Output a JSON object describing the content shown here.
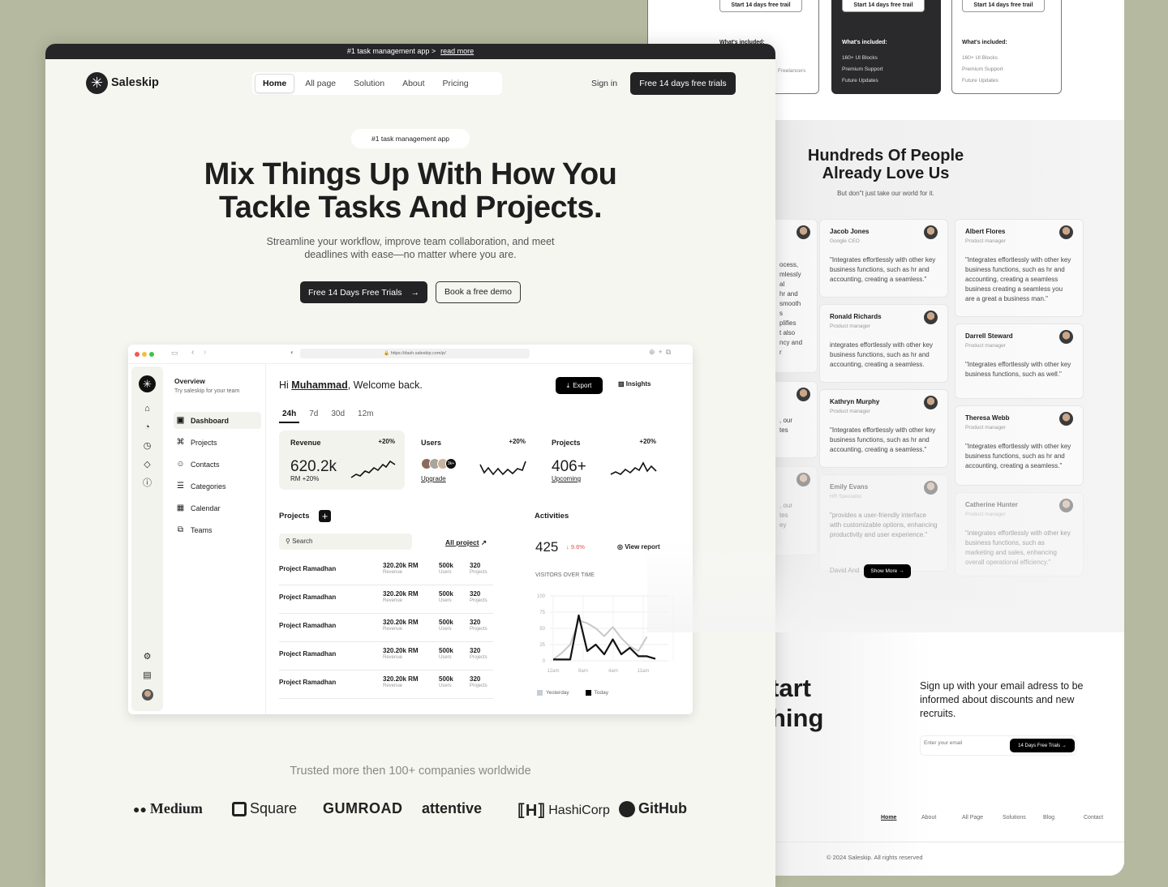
{
  "pricing": {
    "cards": [
      {
        "button": "Start 14 days free trail",
        "included": "What's included:",
        "items": [
          "Freelancers"
        ],
        "style": "light"
      },
      {
        "button": "Start 14 days free trail",
        "included": "What's included:",
        "items": [
          "160+ UI Blocks",
          "Premium Support",
          "Future Updates"
        ],
        "style": "dark"
      },
      {
        "button": "Start 14 days free trail",
        "included": "What's included:",
        "items": [
          "160+ UI Blocks",
          "Premium Support",
          "Future Updates"
        ],
        "style": "light"
      }
    ]
  },
  "testimonials": {
    "title_line1": "Hundreds Of People",
    "title_line2": "Already Love Us",
    "subtitle": "But don\"t just take our world for it.",
    "partial_lines": [
      "ocess,",
      "mlessly",
      "al",
      "hr and",
      "smooth",
      "s",
      "plifies",
      "t also",
      "ncy and",
      "r"
    ],
    "partial_lines2": [
      ", our",
      "tes"
    ],
    "partial_lines3": [
      ", our",
      "tes",
      "ey"
    ],
    "cards": [
      {
        "name": "Jacob Jones",
        "role": "Google CEO",
        "quote": "\"Integrates effortlessly with other key business functions, such as hr and accounting, creating a seamless.\""
      },
      {
        "name": "Ronald Richards",
        "role": "Product manager",
        "quote": "integrates effortlessly with other key business functions, such as hr and accounting, creating a seamless."
      },
      {
        "name": "Kathryn Murphy",
        "role": "Product manager",
        "quote": "\"Integrates effortlessly with other key business functions, such as hr and accounting, creating a seamless.\""
      },
      {
        "name": "Emily Evans",
        "role": "HR Specialist",
        "quote": "\"provides a user-friendly interface with customizable options, enhancing productivity and user experience.\""
      },
      {
        "name": "Albert Flores",
        "role": "Product manager",
        "quote": "\"Integrates effortlessly with other key business functions, such as hr and accounting, creating a seamless business creating a seamless you are a great a business man.\""
      },
      {
        "name": "Darrell Steward",
        "role": "Product manager",
        "quote": "\"Integrates effortlessly with other key business functions, such as well.\""
      },
      {
        "name": "Theresa Webb",
        "role": "Product manager",
        "quote": "\"Integrates effortlessly with other key business functions, such as hr and accounting, creating a seamless.\""
      },
      {
        "name": "Catherine Hunter",
        "role": "Product manager",
        "quote": "\"integrates effortlessly with other key business functions, such as marketing and sales, enhancing overall operational efficiency.\""
      }
    ],
    "partial_name": "David And",
    "show_more": "Show More"
  },
  "newsletter": {
    "heading_fragment1": "tart",
    "heading_fragment2": "hing",
    "text": "Sign up with your email adress to be informed about discounts and new recruits.",
    "email_placeholder": "Enter your email",
    "button": "14 Days Free Trials"
  },
  "footer": {
    "links": [
      "Home",
      "About",
      "All Page",
      "Solutions",
      "Blog",
      "Contact"
    ],
    "copyright": "© 2024 Saleskip. All rights reserved"
  },
  "announcement": {
    "text": "#1 task management app >",
    "link": "read more"
  },
  "header": {
    "brand": "Saleskip",
    "nav": [
      "Home",
      "All page",
      "Solution",
      "About",
      "Pricing"
    ],
    "active": "Home",
    "sign_in": "Sign in",
    "cta": "Free 14 days free trials"
  },
  "hero": {
    "badge": "#1 task management app",
    "title_line1": "Mix Things Up With How You",
    "title_line2": "Tackle Tasks And Projects.",
    "subtitle_line1": "Streamline your workflow, improve team collaboration, and meet",
    "subtitle_line2": "deadlines with ease—no matter where you are.",
    "primary_cta": "Free 14 Days Free Trials",
    "secondary_cta": "Book a free demo"
  },
  "dashboard": {
    "url": "https://dash.saleskip.com/p/",
    "sidebar": {
      "title": "Overview",
      "subtitle": "Try saleskip for your team",
      "items": [
        "Dashboard",
        "Projects",
        "Contacts",
        "Categories",
        "Calendar",
        "Teams"
      ],
      "active": "Dashboard"
    },
    "greeting_prefix": "Hi ",
    "user": "Muhammad",
    "greeting_suffix": ", Welcome back.",
    "export": "Export",
    "insights": "Insights",
    "ranges": [
      "24h",
      "7d",
      "30d",
      "12m"
    ],
    "active_range": "24h",
    "stats": [
      {
        "title": "Revenue",
        "change": "+20%",
        "value": "620.2k",
        "sub": "RM +20%"
      },
      {
        "title": "Users",
        "change": "+20%",
        "avatars_more": "3k+",
        "sub": "Upgrade"
      },
      {
        "title": "Projects",
        "change": "+20%",
        "value": "406+",
        "sub": "Upcoming"
      }
    ],
    "projects": {
      "title": "Projects",
      "search_placeholder": "Search",
      "all_link": "All project",
      "rows": [
        {
          "name": "Project Ramadhan",
          "revenue": "320.20k RM",
          "revenue_label": "Revenue",
          "users": "500k",
          "users_label": "Users",
          "projects": "320",
          "projects_label": "Projects"
        },
        {
          "name": "Project Ramadhan",
          "revenue": "320.20k RM",
          "revenue_label": "Revenue",
          "users": "500k",
          "users_label": "Users",
          "projects": "320",
          "projects_label": "Projects"
        },
        {
          "name": "Project Ramadhan",
          "revenue": "320.20k RM",
          "revenue_label": "Revenue",
          "users": "500k",
          "users_label": "Users",
          "projects": "320",
          "projects_label": "Projects"
        },
        {
          "name": "Project Ramadhan",
          "revenue": "320.20k RM",
          "revenue_label": "Revenue",
          "users": "500k",
          "users_label": "Users",
          "projects": "320",
          "projects_label": "Projects"
        },
        {
          "name": "Project Ramadhan",
          "revenue": "320.20k RM",
          "revenue_label": "Revenue",
          "users": "500k",
          "users_label": "Users",
          "projects": "320",
          "projects_label": "Projects"
        }
      ]
    },
    "activities": {
      "title": "Activities",
      "value": "425",
      "change": "↓ 9.6%",
      "change_color": "#d9534f",
      "view_report": "View report"
    }
  },
  "chart_data": {
    "type": "line",
    "title": "VISITORS OVER TIME",
    "xtick_labels": [
      "12am",
      "8am",
      "4am",
      "11am"
    ],
    "yticks": [
      0,
      25,
      50,
      75,
      100
    ],
    "ylim": [
      0,
      100
    ],
    "grid": true,
    "legend_placement": "bottom-left",
    "series": [
      {
        "name": "Yesterday",
        "color": "#c8c8c8",
        "values": [
          2,
          12,
          25,
          62,
          58,
          50,
          38,
          52,
          35,
          22,
          15,
          37
        ]
      },
      {
        "name": "Today",
        "color": "#111111",
        "values": [
          2,
          2,
          2,
          70,
          15,
          25,
          10,
          33,
          10,
          20,
          7,
          7,
          3
        ]
      }
    ]
  },
  "trusted": {
    "text": "Trusted more then 100+ companies worldwide",
    "logos": [
      "Medium",
      "Square",
      "GUMROAD",
      "attentive",
      "HashiCorp",
      "GitHub"
    ]
  }
}
